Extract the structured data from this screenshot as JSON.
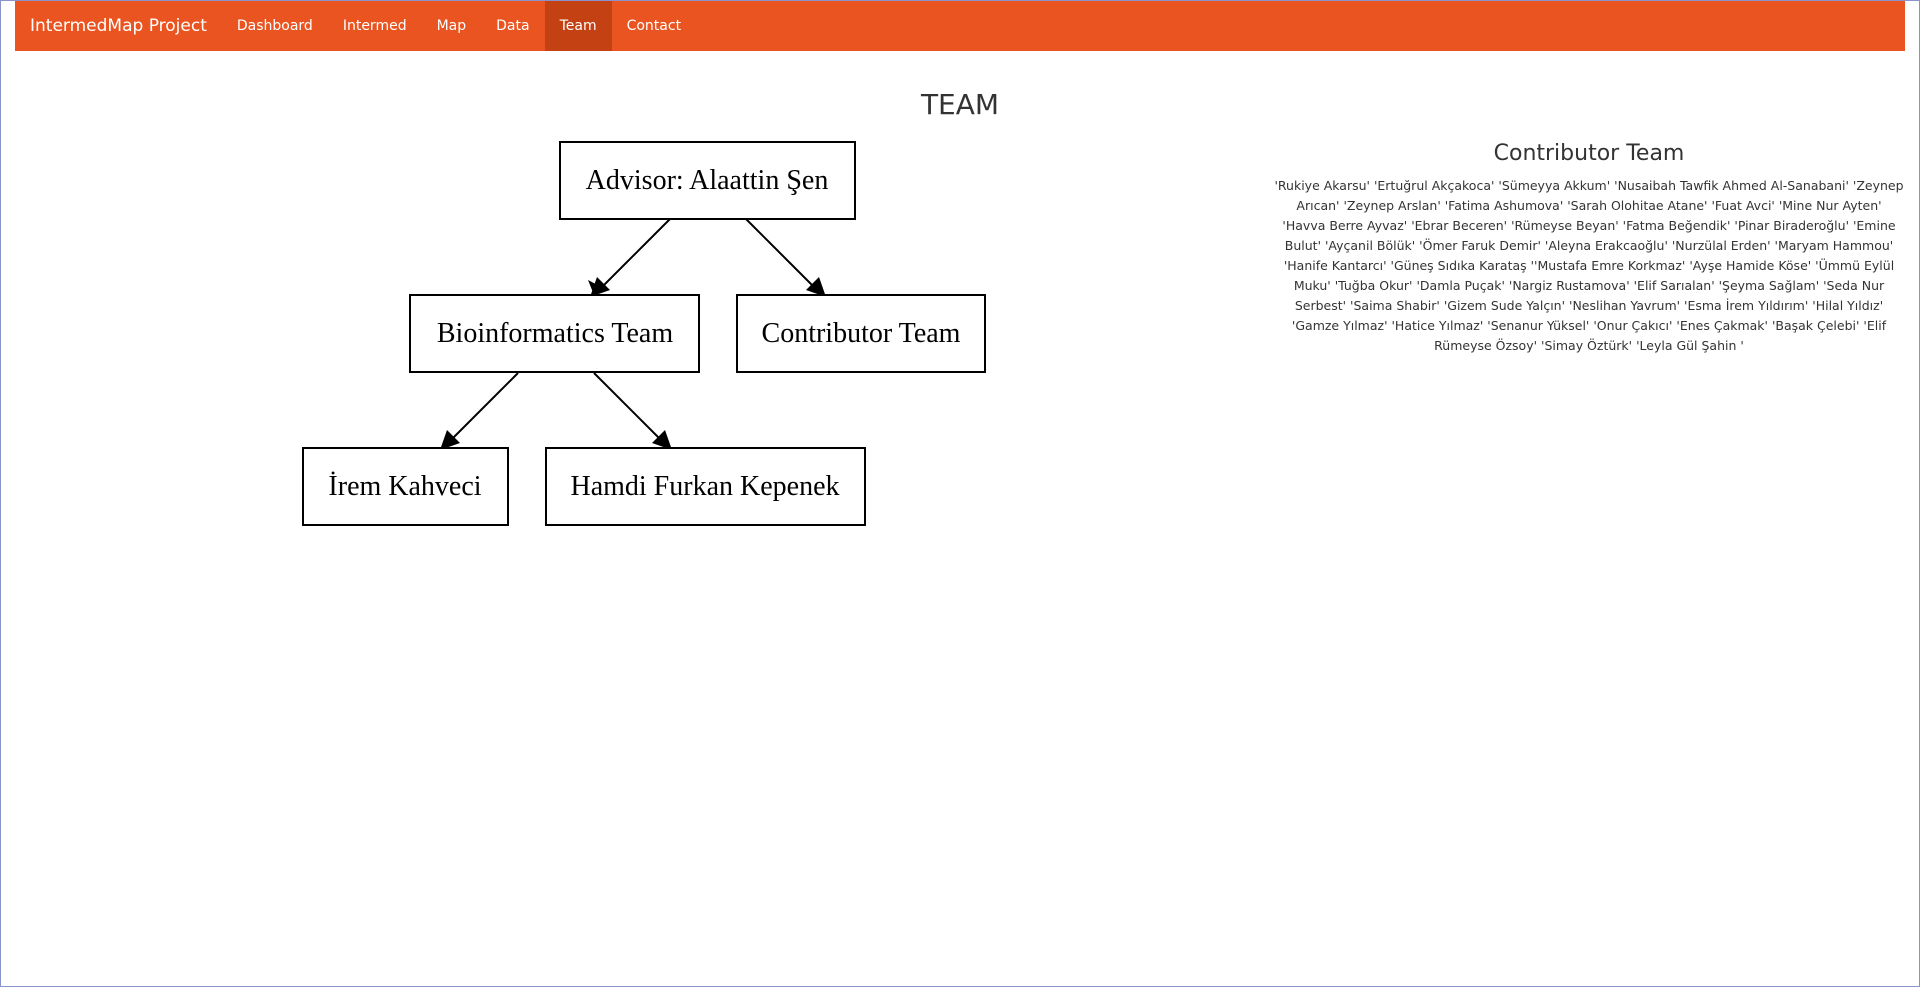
{
  "nav": {
    "brand": "IntermedMap Project",
    "items": [
      {
        "label": "Dashboard"
      },
      {
        "label": "Intermed"
      },
      {
        "label": "Map"
      },
      {
        "label": "Data"
      },
      {
        "label": "Team",
        "active": true
      },
      {
        "label": "Contact"
      }
    ]
  },
  "main": {
    "title": "TEAM"
  },
  "diagram": {
    "advisor": "Advisor: Alaattin Şen",
    "bioinformatics": "Bioinformatics Team",
    "contributor": "Contributor Team",
    "member1": "İrem Kahveci",
    "member2": "Hamdi Furkan Kepenek"
  },
  "contributors": {
    "title": "Contributor Team",
    "text": "'Rukiye Akarsu' 'Ertuğrul Akçakoca' 'Sümeyya Akkum' 'Nusaibah Tawfik Ahmed Al-Sanabani' 'Zeynep Arıcan' 'Zeynep Arslan' 'Fatima Ashumova' 'Sarah Olohitae Atane' 'Fuat Avci' 'Mine Nur Ayten' 'Havva Berre Ayvaz' 'Ebrar Beceren' 'Rümeyse Beyan' 'Fatma Beğendik' 'Pinar Biraderoğlu' 'Emine Bulut' 'Ayçanil Bölük' 'Ömer Faruk Demir' 'Aleyna Erakcaoğlu' 'Nurzülal Erden' 'Maryam Hammou' 'Hanife Kantarcı' 'Güneş Sıdıka Karataş ''Mustafa Emre Korkmaz' 'Ayşe Hamide Köse' 'Ümmü Eylül Muku' 'Tuğba Okur' 'Damla Puçak' 'Nargiz Rustamova' 'Elif Sarıalan' 'Şeyma Sağlam' 'Seda Nur Serbest' 'Saima Shabir' 'Gizem Sude Yalçın' 'Neslihan Yavrum' 'Esma İrem Yıldırım' 'Hilal Yıldız' 'Gamze Yılmaz' 'Hatice Yılmaz' 'Senanur Yüksel' 'Onur Çakıcı' 'Enes Çakmak' 'Başak Çelebi' 'Elif Rümeyse Özsoy' 'Simay Öztürk' 'Leyla Gül Şahin '"
  },
  "colors": {
    "navbar": "#e95420",
    "navbar_active": "#c34113"
  }
}
